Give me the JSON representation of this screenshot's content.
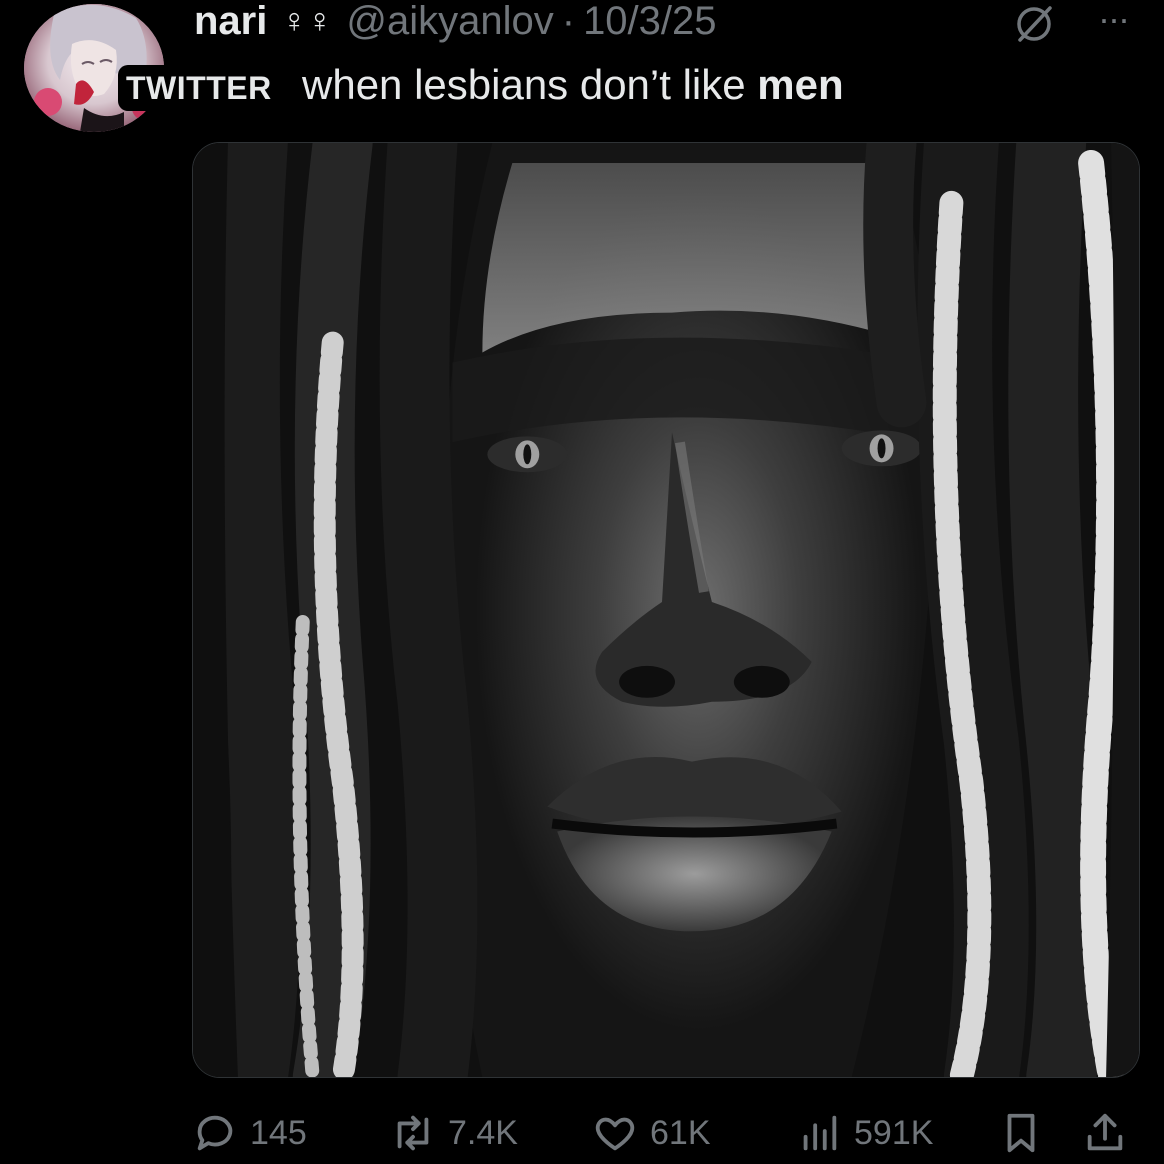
{
  "post": {
    "author": {
      "display_name": "nari",
      "name_emoji": "♀︎♀︎",
      "handle": "@aikyanlov",
      "separator": "·",
      "date": "10/3/25"
    },
    "tag": "TWITTER",
    "text_prefix": "when lesbians don’t like ",
    "text_bold": "men",
    "more_label": "···",
    "actions": {
      "replies": "145",
      "reposts": "7.4K",
      "likes": "61K",
      "views": "591K"
    },
    "icons": {
      "reply": "reply-icon",
      "repost": "repost-icon",
      "like": "heart-icon",
      "views": "views-bar-chart-icon",
      "bookmark": "bookmark-icon",
      "share": "share-icon",
      "grok": "grok-icon",
      "more": "more-dots-icon"
    },
    "colors": {
      "background": "#000000",
      "text": "#e7e9ea",
      "muted": "#71767b",
      "border": "#2f3336"
    }
  }
}
